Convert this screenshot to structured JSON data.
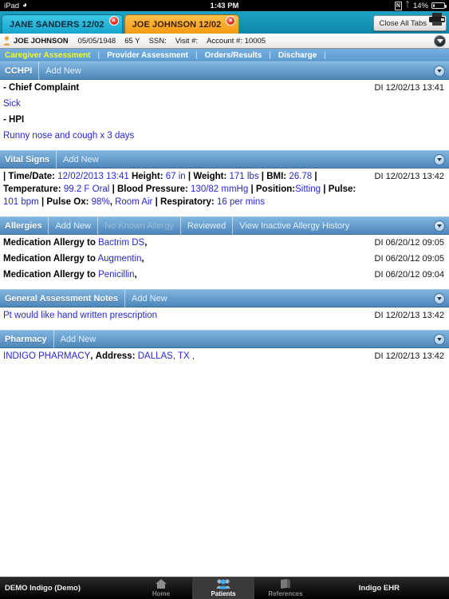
{
  "statusbar": {
    "device": "iPad",
    "wifi_icon": "wifi-icon",
    "time": "1:43 PM",
    "rotation_lock_icon": "rotation-lock-icon",
    "rotation_lock_label": "N",
    "bluetooth_icon": "bluetooth-icon",
    "battery_percent": "14%",
    "battery_icon": "battery-icon"
  },
  "tabstrip": {
    "tabs": [
      {
        "label": "JANE SANDERS 12/02",
        "close_label": "×",
        "active": false
      },
      {
        "label": "JOE JOHNSON 12/02",
        "close_label": "×",
        "active": true
      }
    ],
    "close_all_label": "Close All Tabs",
    "printer_icon": "printer-icon"
  },
  "patientbar": {
    "person_icon": "person-icon",
    "name": "JOE JOHNSON",
    "dob": "05/05/1948",
    "age": "65 Y",
    "ssn": "SSN:",
    "visit": "Visit #:",
    "account": "Account #: 10005",
    "collapse_icon": "chevron-down-icon"
  },
  "secnav": {
    "items": [
      {
        "label": "Caregiver Assessment",
        "active": true
      },
      {
        "label": "Provider Assessment",
        "active": false
      },
      {
        "label": "Orders/Results",
        "active": false
      },
      {
        "label": "Discharge",
        "active": false
      }
    ],
    "separator": "|"
  },
  "sections": {
    "cchpi": {
      "title": "CCHPI",
      "add_new": "Add New",
      "expand_icon": "chevron-down-icon",
      "chief_complaint_label": "- Chief Complaint",
      "chief_complaint_stamp": "DI 12/02/13 13:41",
      "chief_complaint_value": "Sick",
      "hpi_label": "- HPI",
      "hpi_value": "Runny nose and cough x 3 days"
    },
    "vitals": {
      "title": "Vital Signs",
      "add_new": "Add New",
      "expand_icon": "chevron-down-icon",
      "stamp": "DI 12/02/13 13:42",
      "pipe": "|",
      "fields": [
        {
          "label": "Time/Date:",
          "value": "12/02/2013 13:41"
        },
        {
          "label": "Height:",
          "value": "67 in"
        },
        {
          "label": "Weight:",
          "value": "171 lbs"
        },
        {
          "label": "BMI:",
          "value": "26.78"
        },
        {
          "label": "Temperature:",
          "value": "99.2 F Oral"
        },
        {
          "label": "Blood Pressure:",
          "value": "130/82 mmHg"
        },
        {
          "label": "Position:",
          "value": "Sitting"
        },
        {
          "label": "Pulse:",
          "value": "101 bpm"
        },
        {
          "label": "Pulse Ox:",
          "value": "98%"
        },
        {
          "label": "",
          "value": "Room Air"
        },
        {
          "label": "Respiratory:",
          "value": "16 per  mins"
        }
      ]
    },
    "allergies": {
      "title": "Allergies",
      "actions": [
        {
          "label": "Add New",
          "muted": false
        },
        {
          "label": "No Known Allergy",
          "muted": true
        },
        {
          "label": "Reviewed",
          "muted": false
        },
        {
          "label": "View Inactive Allergy History",
          "muted": false
        }
      ],
      "expand_icon": "chevron-down-icon",
      "rows": [
        {
          "label": "Medication Allergy to",
          "value": "Bactrim DS",
          "suffix": ",",
          "stamp": "DI 06/20/12 09:05"
        },
        {
          "label": "Medication Allergy to",
          "value": "Augmentin",
          "suffix": ",",
          "stamp": "DI 06/20/12 09:05"
        },
        {
          "label": "Medication Allergy to",
          "value": "Penicillin",
          "suffix": ",",
          "stamp": "DI 06/20/12 09:04"
        }
      ]
    },
    "notes": {
      "title": "General Assessment Notes",
      "add_new": "Add New",
      "expand_icon": "chevron-down-icon",
      "text": "Pt would like hand written prescription",
      "stamp": "DI 12/02/13 13:42"
    },
    "pharmacy": {
      "title": "Pharmacy",
      "add_new": "Add New",
      "expand_icon": "chevron-down-icon",
      "name": "INDIGO PHARMACY",
      "name_suffix": ",",
      "address_label": "Address:",
      "address_value": "DALLAS, TX ,",
      "stamp": "DI 12/02/13 13:42"
    }
  },
  "bottombar": {
    "left_label": "DEMO Indigo (Demo)",
    "tabs": [
      {
        "label": "Home",
        "icon": "home-icon",
        "selected": false
      },
      {
        "label": "Patients",
        "icon": "patients-icon",
        "selected": true
      },
      {
        "label": "References",
        "icon": "references-icon",
        "selected": false
      }
    ],
    "right_label": "Indigo EHR"
  },
  "colors": {
    "tab_active": "#f59a13",
    "tab_inactive": "#16a6cb",
    "nav_active_text": "#f2ff1e",
    "value_text": "#2727d6",
    "header_blue": "#4d86bb"
  }
}
